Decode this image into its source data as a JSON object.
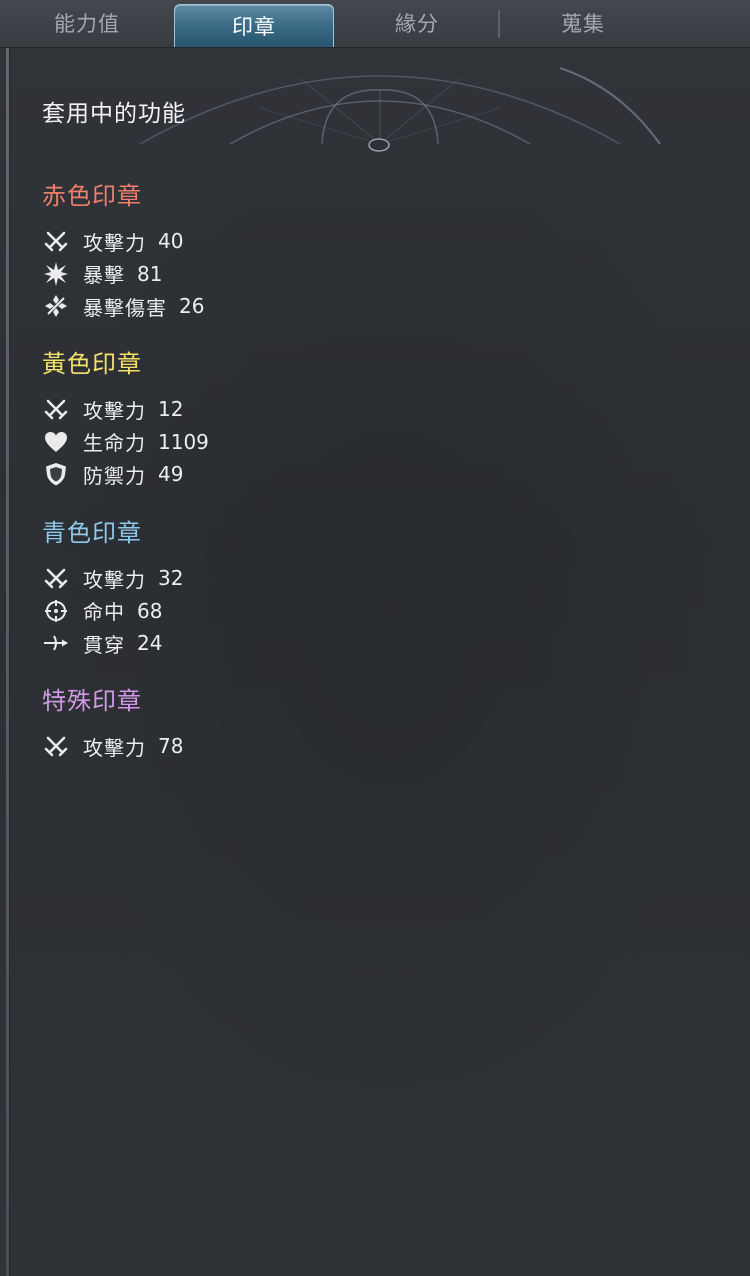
{
  "tabs": [
    {
      "label": "能力值"
    },
    {
      "label": "印章",
      "active": true
    },
    {
      "label": "緣分"
    },
    {
      "label": "蒐集"
    }
  ],
  "panel": {
    "title": "套用中的功能",
    "sections": [
      {
        "title": "赤色印章",
        "color": "#ec7f6e",
        "stats": [
          {
            "icon": "crossed-swords-icon",
            "name": "攻擊力",
            "value": "40"
          },
          {
            "icon": "critical-burst-icon",
            "name": "暴擊",
            "value": "81"
          },
          {
            "icon": "critical-damage-icon",
            "name": "暴擊傷害",
            "value": "26"
          }
        ]
      },
      {
        "title": "黃色印章",
        "color": "#f4e06a",
        "stats": [
          {
            "icon": "crossed-swords-icon",
            "name": "攻擊力",
            "value": "12"
          },
          {
            "icon": "heart-icon",
            "name": "生命力",
            "value": "1109"
          },
          {
            "icon": "shield-icon",
            "name": "防禦力",
            "value": "49"
          }
        ]
      },
      {
        "title": "青色印章",
        "color": "#8ec9ea",
        "stats": [
          {
            "icon": "crossed-swords-icon",
            "name": "攻擊力",
            "value": "32"
          },
          {
            "icon": "crosshair-icon",
            "name": "命中",
            "value": "68"
          },
          {
            "icon": "pierce-icon",
            "name": "貫穿",
            "value": "24"
          }
        ]
      },
      {
        "title": "特殊印章",
        "color": "#d29ae6",
        "stats": [
          {
            "icon": "crossed-swords-icon",
            "name": "攻擊力",
            "value": "78"
          }
        ]
      }
    ]
  }
}
